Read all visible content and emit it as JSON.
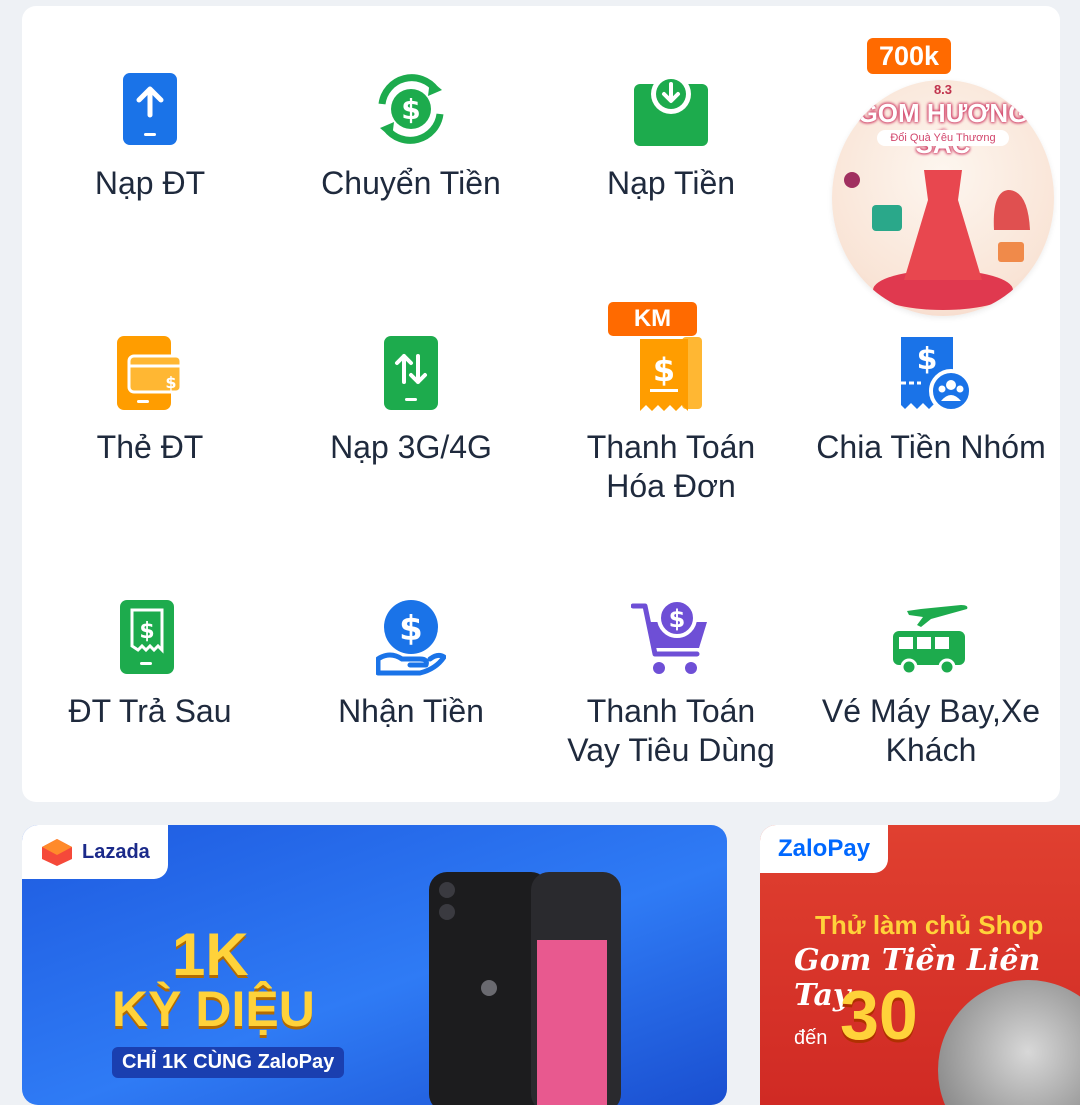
{
  "services": [
    {
      "label": "Nạp ĐT",
      "icon": "phone-topup-icon"
    },
    {
      "label": "Chuyển Tiền",
      "icon": "money-transfer-icon"
    },
    {
      "label": "Nạp Tiền",
      "icon": "deposit-icon"
    },
    {
      "label": "Thẻ ĐT",
      "icon": "phone-card-icon"
    },
    {
      "label": "Nạp 3G/4G",
      "icon": "data-topup-icon"
    },
    {
      "label": "Thanh Toán\nHóa Đơn",
      "icon": "bill-payment-icon",
      "badge": "KM"
    },
    {
      "label": "Chia Tiền Nhóm",
      "icon": "group-split-icon"
    },
    {
      "label": "ĐT Trả Sau",
      "icon": "postpaid-icon"
    },
    {
      "label": "Nhận Tiền",
      "icon": "receive-money-icon"
    },
    {
      "label": "Thanh Toán\nVay Tiêu Dùng",
      "icon": "loan-payment-icon"
    },
    {
      "label": "Vé Máy Bay,Xe\nKhách",
      "icon": "flight-bus-icon"
    }
  ],
  "promo": {
    "badge": "700k",
    "date": "8.3",
    "title": "GOM HƯƠNG SẮC",
    "subtitle": "Đổi Quà Yêu Thương"
  },
  "banner_left": {
    "brand": "Lazada",
    "line1": "1K",
    "line2": "KỲ DIỆU",
    "line3": "CHỈ 1K CÙNG ZaloPay"
  },
  "banner_right": {
    "brand": "ZaloPay",
    "line1": "Thử làm chủ Shop",
    "line2": "Gom Tiền Liền Tay",
    "prefix": "đến",
    "amount": "30"
  },
  "colors": {
    "blue": "#1a73e8",
    "green": "#1dab4d",
    "orange": "#ff9d00",
    "purple": "#6e4fd6",
    "badge": "#ff6a00"
  }
}
